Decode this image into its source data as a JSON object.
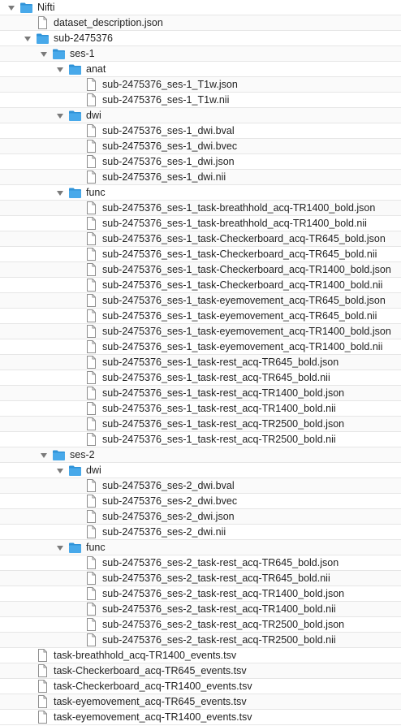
{
  "tree": [
    {
      "label": "Nifti",
      "kind": "folder",
      "depth": 0,
      "open": true
    },
    {
      "label": "dataset_description.json",
      "kind": "file",
      "depth": 1
    },
    {
      "label": "sub-2475376",
      "kind": "folder",
      "depth": 1,
      "open": true
    },
    {
      "label": "ses-1",
      "kind": "folder",
      "depth": 2,
      "open": true
    },
    {
      "label": "anat",
      "kind": "folder",
      "depth": 3,
      "open": true
    },
    {
      "label": "sub-2475376_ses-1_T1w.json",
      "kind": "file",
      "depth": 4
    },
    {
      "label": "sub-2475376_ses-1_T1w.nii",
      "kind": "file",
      "depth": 4
    },
    {
      "label": "dwi",
      "kind": "folder",
      "depth": 3,
      "open": true
    },
    {
      "label": "sub-2475376_ses-1_dwi.bval",
      "kind": "file",
      "depth": 4
    },
    {
      "label": "sub-2475376_ses-1_dwi.bvec",
      "kind": "file",
      "depth": 4
    },
    {
      "label": "sub-2475376_ses-1_dwi.json",
      "kind": "file",
      "depth": 4
    },
    {
      "label": "sub-2475376_ses-1_dwi.nii",
      "kind": "file",
      "depth": 4
    },
    {
      "label": "func",
      "kind": "folder",
      "depth": 3,
      "open": true
    },
    {
      "label": "sub-2475376_ses-1_task-breathhold_acq-TR1400_bold.json",
      "kind": "file",
      "depth": 4
    },
    {
      "label": "sub-2475376_ses-1_task-breathhold_acq-TR1400_bold.nii",
      "kind": "file",
      "depth": 4
    },
    {
      "label": "sub-2475376_ses-1_task-Checkerboard_acq-TR645_bold.json",
      "kind": "file",
      "depth": 4
    },
    {
      "label": "sub-2475376_ses-1_task-Checkerboard_acq-TR645_bold.nii",
      "kind": "file",
      "depth": 4
    },
    {
      "label": "sub-2475376_ses-1_task-Checkerboard_acq-TR1400_bold.json",
      "kind": "file",
      "depth": 4
    },
    {
      "label": "sub-2475376_ses-1_task-Checkerboard_acq-TR1400_bold.nii",
      "kind": "file",
      "depth": 4
    },
    {
      "label": "sub-2475376_ses-1_task-eyemovement_acq-TR645_bold.json",
      "kind": "file",
      "depth": 4
    },
    {
      "label": "sub-2475376_ses-1_task-eyemovement_acq-TR645_bold.nii",
      "kind": "file",
      "depth": 4
    },
    {
      "label": "sub-2475376_ses-1_task-eyemovement_acq-TR1400_bold.json",
      "kind": "file",
      "depth": 4
    },
    {
      "label": "sub-2475376_ses-1_task-eyemovement_acq-TR1400_bold.nii",
      "kind": "file",
      "depth": 4
    },
    {
      "label": "sub-2475376_ses-1_task-rest_acq-TR645_bold.json",
      "kind": "file",
      "depth": 4
    },
    {
      "label": "sub-2475376_ses-1_task-rest_acq-TR645_bold.nii",
      "kind": "file",
      "depth": 4
    },
    {
      "label": "sub-2475376_ses-1_task-rest_acq-TR1400_bold.json",
      "kind": "file",
      "depth": 4
    },
    {
      "label": "sub-2475376_ses-1_task-rest_acq-TR1400_bold.nii",
      "kind": "file",
      "depth": 4
    },
    {
      "label": "sub-2475376_ses-1_task-rest_acq-TR2500_bold.json",
      "kind": "file",
      "depth": 4
    },
    {
      "label": "sub-2475376_ses-1_task-rest_acq-TR2500_bold.nii",
      "kind": "file",
      "depth": 4
    },
    {
      "label": "ses-2",
      "kind": "folder",
      "depth": 2,
      "open": true
    },
    {
      "label": "dwi",
      "kind": "folder",
      "depth": 3,
      "open": true
    },
    {
      "label": "sub-2475376_ses-2_dwi.bval",
      "kind": "file",
      "depth": 4
    },
    {
      "label": "sub-2475376_ses-2_dwi.bvec",
      "kind": "file",
      "depth": 4
    },
    {
      "label": "sub-2475376_ses-2_dwi.json",
      "kind": "file",
      "depth": 4
    },
    {
      "label": "sub-2475376_ses-2_dwi.nii",
      "kind": "file",
      "depth": 4
    },
    {
      "label": "func",
      "kind": "folder",
      "depth": 3,
      "open": true
    },
    {
      "label": "sub-2475376_ses-2_task-rest_acq-TR645_bold.json",
      "kind": "file",
      "depth": 4
    },
    {
      "label": "sub-2475376_ses-2_task-rest_acq-TR645_bold.nii",
      "kind": "file",
      "depth": 4
    },
    {
      "label": "sub-2475376_ses-2_task-rest_acq-TR1400_bold.json",
      "kind": "file",
      "depth": 4
    },
    {
      "label": "sub-2475376_ses-2_task-rest_acq-TR1400_bold.nii",
      "kind": "file",
      "depth": 4
    },
    {
      "label": "sub-2475376_ses-2_task-rest_acq-TR2500_bold.json",
      "kind": "file",
      "depth": 4
    },
    {
      "label": "sub-2475376_ses-2_task-rest_acq-TR2500_bold.nii",
      "kind": "file",
      "depth": 4
    },
    {
      "label": "task-breathhold_acq-TR1400_events.tsv",
      "kind": "file",
      "depth": 1
    },
    {
      "label": "task-Checkerboard_acq-TR645_events.tsv",
      "kind": "file",
      "depth": 1
    },
    {
      "label": "task-Checkerboard_acq-TR1400_events.tsv",
      "kind": "file",
      "depth": 1
    },
    {
      "label": "task-eyemovement_acq-TR645_events.tsv",
      "kind": "file",
      "depth": 1
    },
    {
      "label": "task-eyemovement_acq-TR1400_events.tsv",
      "kind": "file",
      "depth": 1
    }
  ],
  "colors": {
    "folder": "#48a9ea",
    "folder_tab": "#2f93d8",
    "file_fill": "#ffffff",
    "file_stroke": "#8e8e8e",
    "disclosure": "#7a7a7a"
  }
}
